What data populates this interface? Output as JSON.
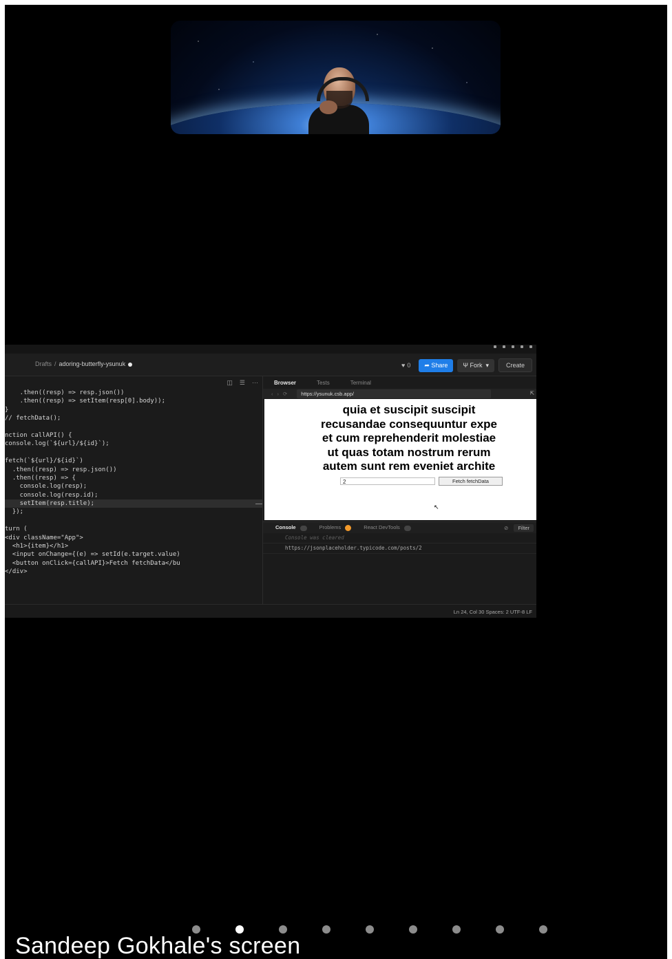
{
  "video": {
    "participant_label": ""
  },
  "editor": {
    "breadcrumb": {
      "folder": "Drafts",
      "project": "adoring-butterfly-ysunuk"
    },
    "header": {
      "like_count": "0",
      "share_label": "Share",
      "fork_label": "Fork",
      "create_label": "Create"
    },
    "code_lines": [
      "    .then((resp) => resp.json())",
      "    .then((resp) => setItem(resp[0].body));",
      "}",
      "// fetchData();",
      "",
      "nction callAPI() {",
      "console.log(`${url}/${id}`);",
      "",
      "fetch(`${url}/${id}`)",
      "  .then((resp) => resp.json())",
      "  .then((resp) => {",
      "    console.log(resp);",
      "    console.log(resp.id);",
      "    setItem(resp.title);",
      "  });",
      "",
      "turn (",
      "<div className=\"App\">",
      "  <h1>{item}</h1>",
      "  <input onChange={(e) => setId(e.target.value)",
      "  <button onClick={callAPI}>Fetch fetchData</bu",
      "</div>"
    ],
    "preview": {
      "tabs": [
        "Browser",
        "Tests",
        "Terminal"
      ],
      "active_tab": "Browser",
      "url": "https://ysunuk.csb.app/",
      "page_heading_lines": [
        "quia et suscipit suscipit",
        "recusandae consequuntur expe",
        "et cum reprehenderit molestiae",
        "ut quas totam nostrum rerum",
        "autem sunt rem eveniet archite"
      ],
      "input_value": "2",
      "button_label": "Fetch fetchData"
    },
    "console": {
      "tabs": [
        "Console",
        "Problems",
        "React DevTools"
      ],
      "filter_label": "Filter",
      "lines": [
        "Console was cleared",
        "https://jsonplaceholder.typicode.com/posts/2"
      ]
    },
    "status": {
      "text": "Ln 24, Col 30   Spaces: 2   UTF-8   LF"
    }
  },
  "pager": {
    "count": 9,
    "active_index": 1
  },
  "caption": "Sandeep Gokhale's screen"
}
